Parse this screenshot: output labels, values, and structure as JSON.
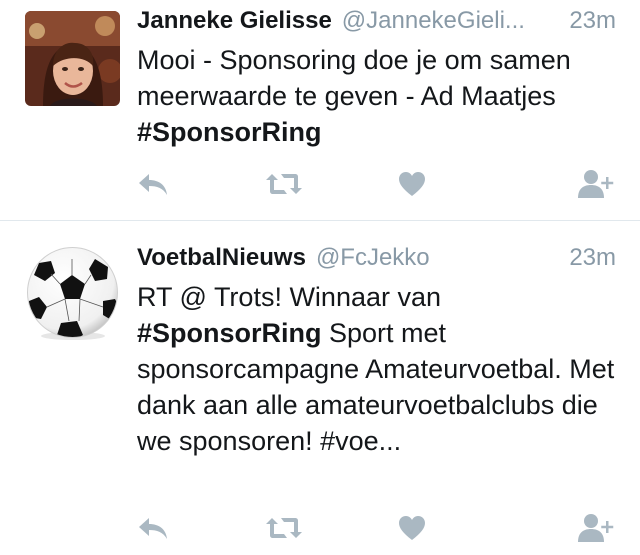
{
  "colors": {
    "muted": "#8899a6",
    "text": "#14171a",
    "divider": "#e1e8ed",
    "icon": "#aab8c2"
  },
  "tweets": [
    {
      "name": "Janneke Gielisse",
      "handle": "@JannekeGieli...",
      "time": "23m",
      "text_1": "Mooi - Sponsoring doe je om samen meerwaarde te geven - Ad Maatjes ",
      "hashtag_1": "#SponsorRing",
      "avatar_icon": "profile-photo"
    },
    {
      "name": "VoetbalNieuws",
      "handle": "@FcJekko",
      "time": "23m",
      "text_1": "RT @ Trots! Winnaar van ",
      "hashtag_1": "#SponsorRing",
      "text_2": " Sport met sponsorcampagne Amateurvoetbal. Met dank aan alle amateurvoetbalclubs die we sponsoren! #voe...",
      "avatar_icon": "soccer-ball"
    }
  ],
  "action_icons": [
    "reply-icon",
    "retweet-icon",
    "like-icon",
    "follow-icon"
  ]
}
